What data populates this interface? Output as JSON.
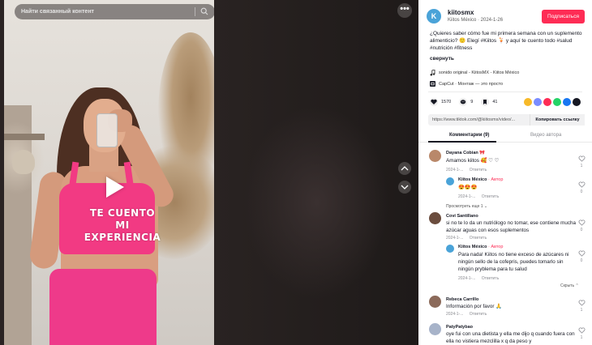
{
  "video": {
    "search_placeholder": "Найти связанный контент",
    "overlay_text": "TE CUENTO MI EXPERIENCIA",
    "more_label": "•••"
  },
  "author": {
    "avatar_letter": "K",
    "username": "kiitosmx",
    "subtitle": "Kiitos México · 2024-1-26",
    "follow_label": "Подписаться"
  },
  "description": "¿Quieres saber cómo fue mi primera semana con un suplemento alimenticio? 🙂 Elegí #Kiitos 🍹 y aquí te cuento todo #salud #nutrición #fitness",
  "collapse_label": "свернуть",
  "sound": "sonido original - KiitosMX - Kiitos México",
  "capcut": "CapCut · Монтаж — это просто",
  "stats": {
    "likes": "1570",
    "comments": "9",
    "saves": "41"
  },
  "share_colors": [
    "#f7b928",
    "#7a8cff",
    "#fe2c55",
    "#25d366",
    "#1877f2",
    "#161823"
  ],
  "link": {
    "url": "https://www.tiktok.com/@kiitosmx/video/...",
    "copy_label": "Копировать ссылку"
  },
  "tabs": {
    "comments": "Комментарии (9)",
    "author_videos": "Видео автора"
  },
  "comments": [
    {
      "name": "Dayana Cobian 🎀",
      "text": "Amamos kiitos 🥰 ♡ ♡",
      "date": "2024-1-...",
      "reply": "Ответить",
      "likes": "1",
      "avatar_color": "#b9886a",
      "replies": [
        {
          "name": "Kiitos México",
          "badge": "· Автор",
          "text": "😍😍😍",
          "date": "2024-1-...",
          "reply": "Ответить",
          "likes": "0"
        }
      ],
      "more_replies": "Просмотреть еще 1 ⌄"
    },
    {
      "name": "Covi Santillano",
      "text": "si no te lo da un nutriólogo no tomar, ese contiene mucha azúcar aguas con esos suplementos",
      "date": "2024-1-...",
      "reply": "Ответить",
      "likes": "0",
      "avatar_color": "#6b4d3e",
      "replies": [
        {
          "name": "Kiitos México",
          "badge": "· Автор",
          "text": "Para nada! Kiitos no tiene exceso de azúcares ni ningún sello de la cofepris, puedes tomarlo sin ningún pryblema para tu salud",
          "date": "2024-1-...",
          "reply": "Ответить",
          "likes": "0"
        }
      ],
      "hide_label": "Скрыть ⌃"
    },
    {
      "name": "Rebeca Carrillo",
      "text": "Información por favor 🙏",
      "date": "2024-1-...",
      "reply": "Ответить",
      "likes": "1",
      "avatar_color": "#8b6a5a"
    },
    {
      "name": "PatyPatybao",
      "text": "oye fui con una dietista y ella me dijo q cuando fuera con ella no vistiera mezclilla x q da peso y",
      "date": "",
      "reply": "",
      "likes": "1",
      "avatar_color": "#a7b3c9"
    }
  ]
}
